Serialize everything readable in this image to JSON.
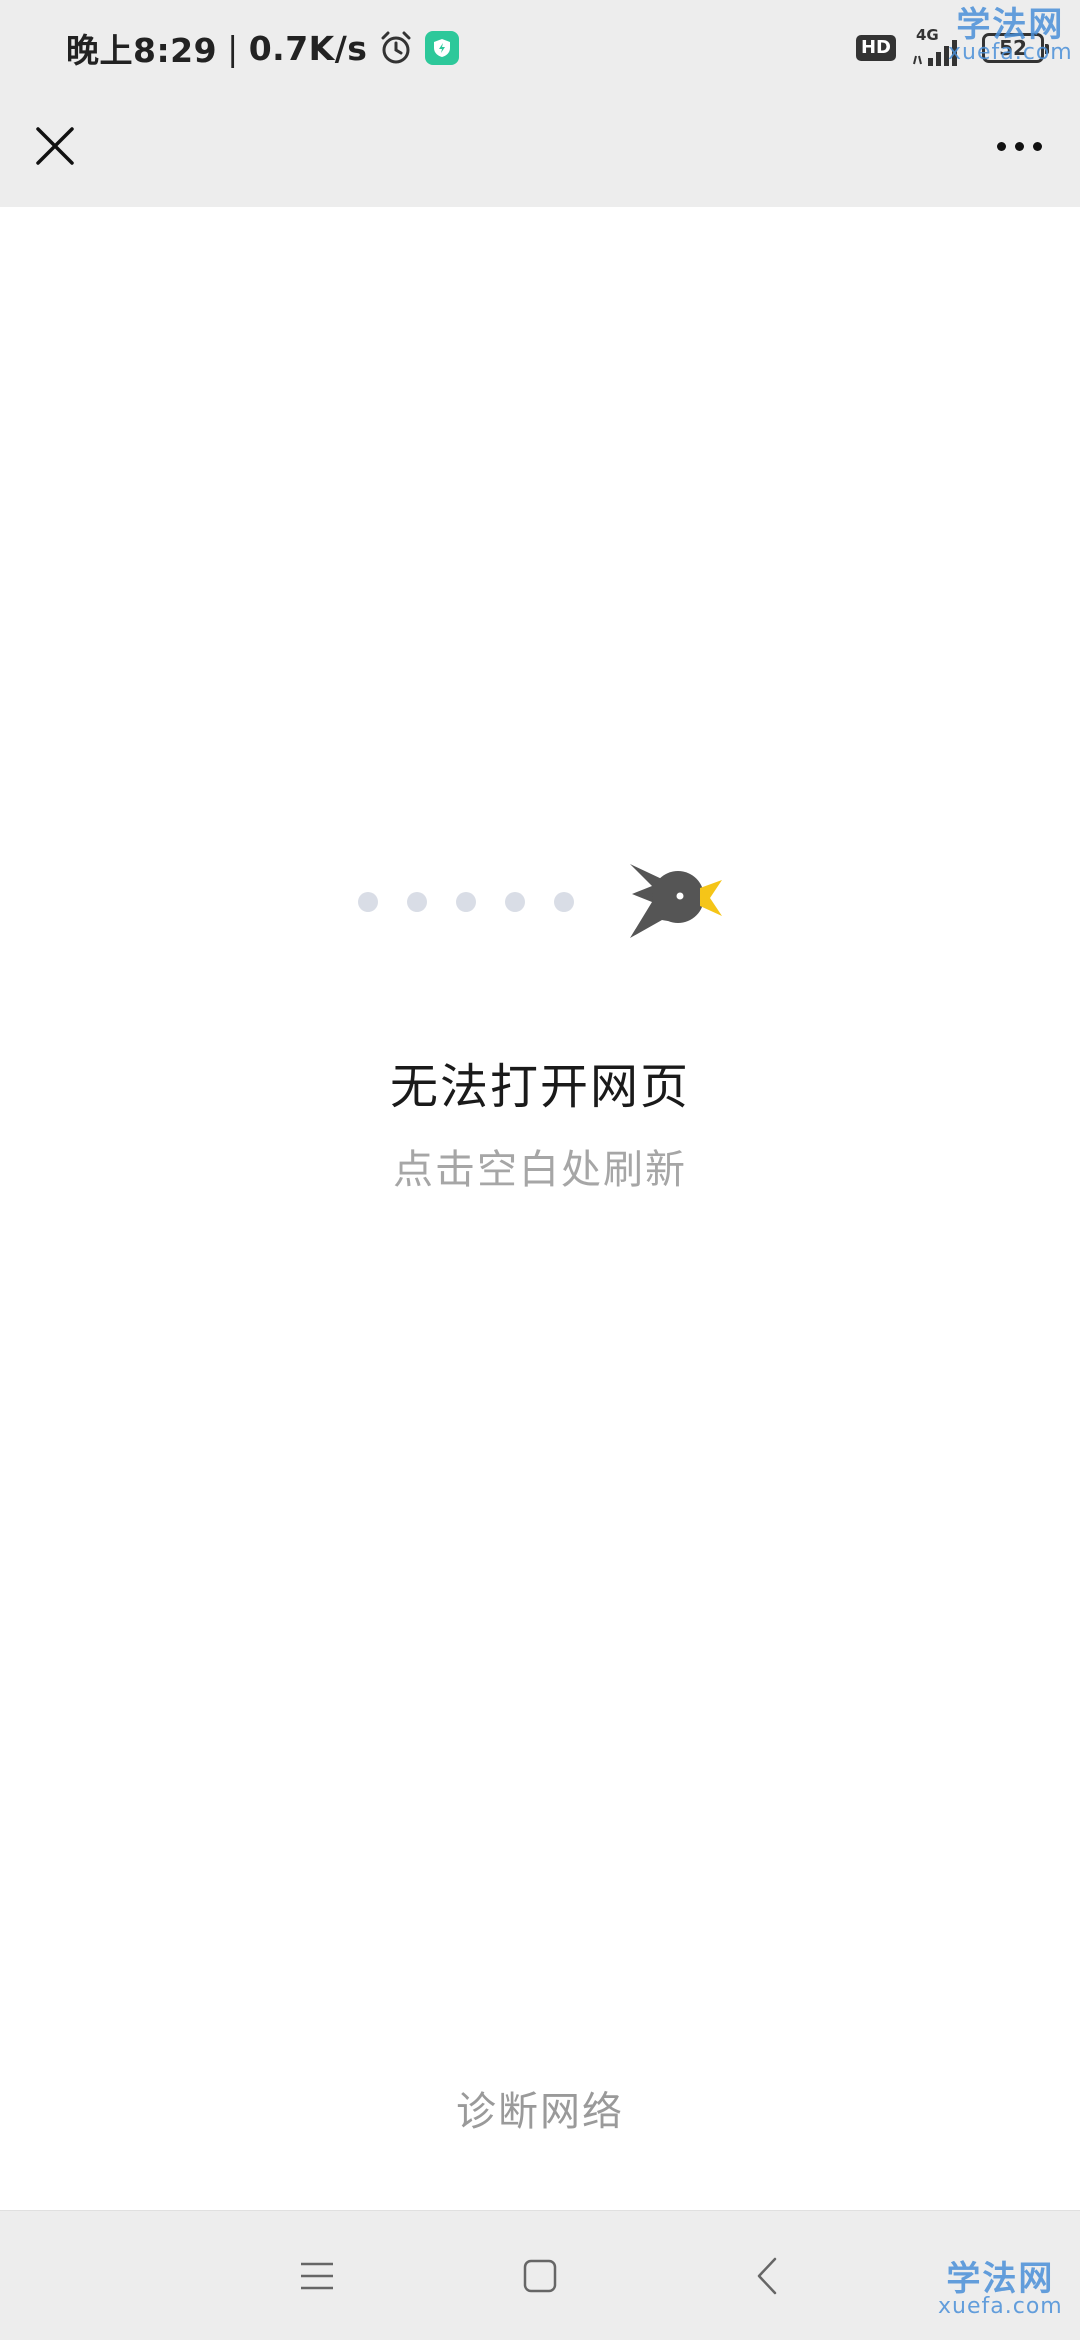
{
  "status_bar": {
    "time": "晚上8:29",
    "separator": "|",
    "net_speed": "0.7K/s",
    "hd_label": "HD",
    "network_type": "4G",
    "battery": "52"
  },
  "watermark": {
    "brand": "学法网",
    "domain": "xuefa.com"
  },
  "title_bar": {
    "close_icon": "close-icon",
    "more_icon": "more-icon"
  },
  "content": {
    "error_title": "无法打开网页",
    "error_hint": "点击空白处刷新",
    "diagnose_label": "诊断网络"
  },
  "illustration": {
    "bird_color": "#555555",
    "beak_color": "#f5c518",
    "trail_color": "#d9dde6"
  },
  "nav_bar": {
    "menu_icon": "menu-icon",
    "home_icon": "home-icon",
    "back_icon": "back-icon"
  }
}
